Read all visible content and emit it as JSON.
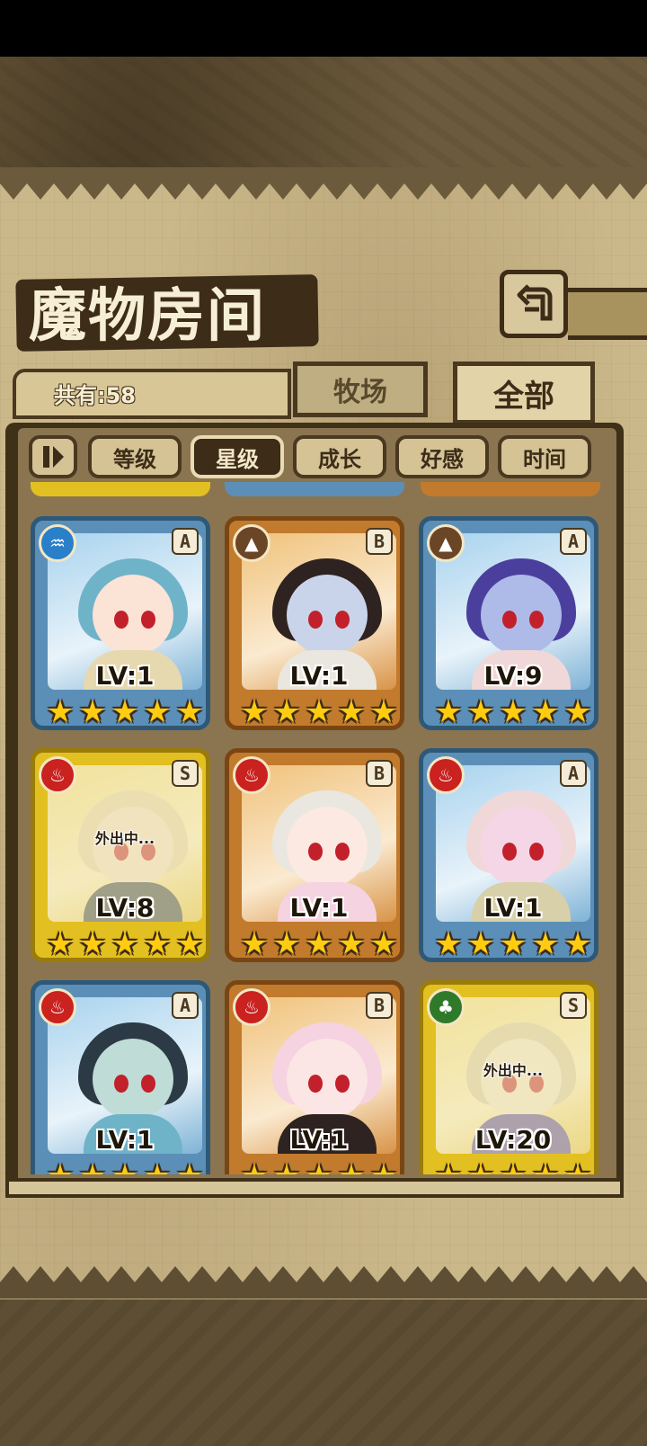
{
  "title": "魔物房间",
  "count_label": "共有:58",
  "tabs": {
    "pasture": "牧场",
    "all": "全部"
  },
  "sort_buttons": {
    "toggle_icon": "pause-sort-icon",
    "items": [
      {
        "label": "等级",
        "active": false
      },
      {
        "label": "星级",
        "active": true
      },
      {
        "label": "成长",
        "active": false
      },
      {
        "label": "好感",
        "active": false
      },
      {
        "label": "时间",
        "active": false
      }
    ]
  },
  "cards": [
    {
      "element": "water",
      "rank": "A",
      "level": "LV:1",
      "stars": 5,
      "away": false,
      "away_text": ""
    },
    {
      "element": "earth",
      "rank": "B",
      "level": "LV:1",
      "stars": 5,
      "away": false,
      "away_text": ""
    },
    {
      "element": "earth",
      "rank": "A",
      "level": "LV:9",
      "stars": 5,
      "away": false,
      "away_text": ""
    },
    {
      "element": "fire",
      "rank": "S",
      "level": "LV:8",
      "stars": 5,
      "away": true,
      "away_text": "外出中..."
    },
    {
      "element": "fire",
      "rank": "B",
      "level": "LV:1",
      "stars": 5,
      "away": false,
      "away_text": ""
    },
    {
      "element": "fire",
      "rank": "A",
      "level": "LV:1",
      "stars": 5,
      "away": false,
      "away_text": ""
    },
    {
      "element": "fire",
      "rank": "A",
      "level": "LV:1",
      "stars": 5,
      "away": false,
      "away_text": ""
    },
    {
      "element": "fire",
      "rank": "B",
      "level": "LV:1",
      "stars": 5,
      "away": false,
      "away_text": ""
    },
    {
      "element": "grass",
      "rank": "S",
      "level": "LV:20",
      "stars": 5,
      "away": true,
      "away_text": "外出中..."
    }
  ],
  "colors": {
    "rarity_A": "#5b8fb8",
    "rarity_B": "#c27a2c",
    "rarity_S": "#e3c021",
    "star": "#ffcc10",
    "element_water": "#2a7fc9",
    "element_earth": "#6a4526",
    "element_fire": "#c9221f",
    "element_grass": "#2f7a2a"
  }
}
